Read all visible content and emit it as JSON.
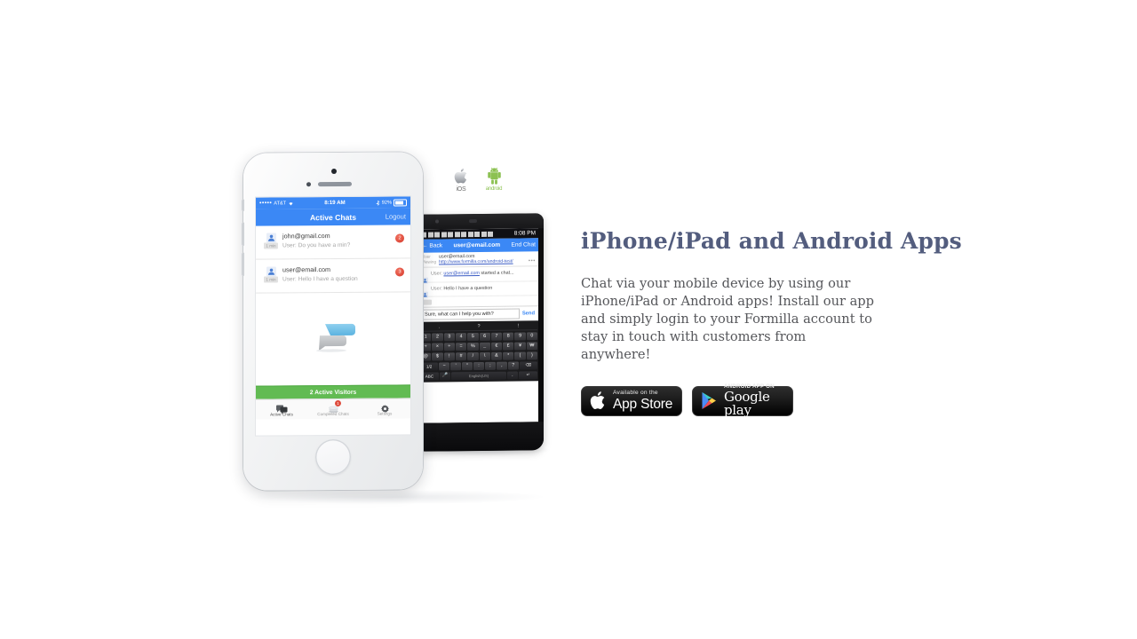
{
  "section": {
    "heading": "iPhone/iPad and Android Apps",
    "body": "Chat via your mobile device by using our iPhone/iPad or Android apps! Install our app and simply login to your Formilla account to stay in touch with customers from anywhere!"
  },
  "badges": {
    "app_store": {
      "small": "Available on the",
      "big": "App Store",
      "icon": "apple-icon"
    },
    "google_play": {
      "small": "ANDROID APP ON",
      "big": "Google play",
      "icon": "google-play-triangle-icon"
    }
  },
  "os_logos": [
    {
      "name": "apple-logo",
      "caption": "iOS"
    },
    {
      "name": "android-logo",
      "caption": "android"
    }
  ],
  "iphone": {
    "status_bar": {
      "carrier": "AT&T",
      "signal_dots": "•••••",
      "wifi": "wifi-icon",
      "time": "8:19 AM",
      "battery_percent": "92%",
      "bluetooth": "bluetooth-icon"
    },
    "nav_bar": {
      "title": "Active Chats",
      "logout": "Logout"
    },
    "chats": [
      {
        "email": "john@gmail.com",
        "snippet": "User: Do you have a min?",
        "time": "1 min",
        "badge": "2"
      },
      {
        "email": "user@email.com",
        "snippet": "User: Hello I have a question",
        "time": "1 min",
        "badge": "3"
      }
    ],
    "logo": "formilla-speech-bubble-logo",
    "visitors_bar": "2 Active Visitors",
    "tabs": [
      {
        "label": "Active Chats",
        "icon": "chat-bubbles-icon",
        "active": true,
        "badge": ""
      },
      {
        "label": "Completed Chats",
        "icon": "completed-chats-icon",
        "active": false,
        "badge": "1"
      },
      {
        "label": "Settings",
        "icon": "gear-icon",
        "active": false,
        "badge": ""
      }
    ]
  },
  "android": {
    "status_bar": {
      "time": "8:08 PM"
    },
    "nav_bar": {
      "back": "← Back",
      "title": "user@email.com",
      "end_chat": "End Chat"
    },
    "meta": [
      {
        "label": "User",
        "value": "user@email.com",
        "is_link": false
      },
      {
        "label": "Viewing",
        "value": "http://www.formilla.com/android-test/",
        "is_link": true
      }
    ],
    "messages": [
      {
        "prefix": "User:",
        "link": "user@email.com",
        "suffix": " started a chat..."
      },
      {
        "prefix": "User:",
        "link": "",
        "suffix": " Hello I have a question"
      }
    ],
    "input": {
      "value": "Sure, what can I help you with?",
      "send_label": "Send"
    },
    "keyboard": {
      "suggestions": [
        ".",
        "?",
        "!"
      ],
      "rows": [
        [
          "1",
          "2",
          "3",
          "4",
          "5",
          "6",
          "7",
          "8",
          "9",
          "0"
        ],
        [
          "+",
          "×",
          "÷",
          "=",
          "%",
          "_",
          "€",
          "£",
          "¥",
          "₩"
        ],
        [
          "@",
          "$",
          "!",
          "#",
          "/",
          "\\",
          "&",
          "*",
          "(",
          ")"
        ],
        [
          "1/2",
          "−",
          "'",
          "\"",
          ":",
          ";",
          ",",
          "?",
          "⌫"
        ],
        [
          "ABC",
          "🎤",
          "English(US)",
          ".",
          "↵"
        ]
      ]
    }
  },
  "colors": {
    "heading": "#535d7e",
    "body_text": "#55565a",
    "ios_blue": "#3b88f5",
    "green": "#62bb53",
    "badge_red": "#de4b3c",
    "android_green": "#8cc152",
    "page_bg": "#ffffff"
  }
}
